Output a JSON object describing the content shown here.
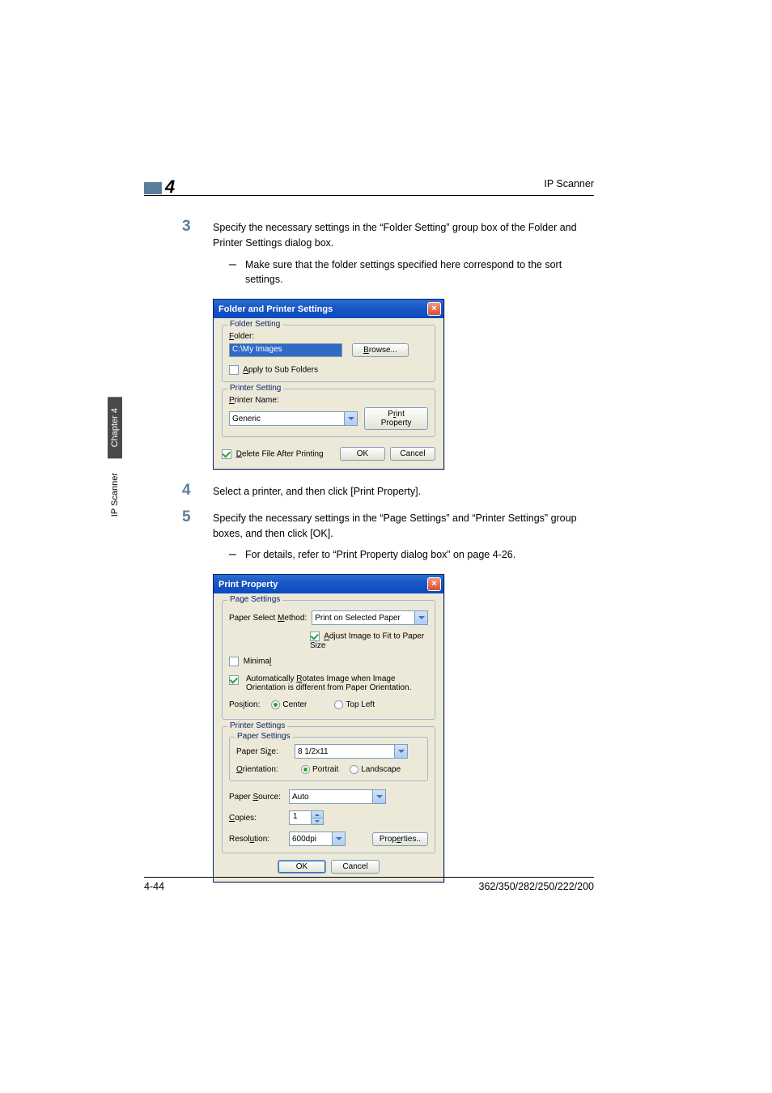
{
  "header": {
    "chapter_number": "4",
    "right_text": "IP Scanner"
  },
  "side_tab": {
    "dark": "Chapter 4",
    "light": "IP Scanner"
  },
  "steps": {
    "s3": {
      "num": "3",
      "text": "Specify the necessary settings in the “Folder Setting” group box of the Folder and Printer Settings dialog box.",
      "bullet": "Make sure that the folder settings specified here correspond to the sort settings."
    },
    "s4": {
      "num": "4",
      "text": "Select a printer, and then click [Print Property]."
    },
    "s5": {
      "num": "5",
      "text": "Specify the necessary settings in the “Page Settings” and “Printer Settings” group boxes, and then click [OK].",
      "bullet": "For details, refer to “Print Property dialog box” on page 4-26."
    }
  },
  "dialog1": {
    "title": "Folder and Printer Settings",
    "folder_setting": {
      "legend": "Folder Setting",
      "folder_label": "Folder:",
      "folder_label_u": "F",
      "folder_value": "C:\\My Images",
      "browse": "Browse...",
      "browse_u": "B",
      "apply_sub": "Apply to Sub Folders",
      "apply_sub_u": "A"
    },
    "printer_setting": {
      "legend": "Printer Setting",
      "printer_label": "Printer Name:",
      "printer_label_u": "P",
      "printer_value": "Generic",
      "print_property": "Print Property",
      "print_property_u": "r"
    },
    "delete_after": "Delete File After Printing",
    "delete_after_u": "D",
    "ok": "OK",
    "cancel": "Cancel"
  },
  "dialog2": {
    "title": "Print Property",
    "page_settings": {
      "legend": "Page Settings",
      "method_label": "Paper Select Method:",
      "method_u": "M",
      "method_value": "Print on Selected Paper",
      "adjust": "Adjust Image to Fit to Paper Size",
      "adjust_u": "A",
      "minimal": "Minimal",
      "minimal_u": "l",
      "auto_rotate": "Automatically Rotates Image when Image Orientation is different from Paper Orientation.",
      "auto_rotate_u": "R",
      "position_label": "Position:",
      "position_u": "i",
      "pos_center": "Center",
      "pos_topleft": "Top Left"
    },
    "printer_settings": {
      "legend": "Printer Settings",
      "paper_settings_legend": "Paper Settings",
      "paper_size_label": "Paper Size:",
      "paper_size_u": "z",
      "paper_size_value": "8 1/2x11",
      "orientation_label": "Orientation:",
      "orientation_u": "O",
      "or_portrait": "Portrait",
      "or_landscape": "Landscape",
      "source_label": "Paper Source:",
      "source_u": "S",
      "source_value": "Auto",
      "copies_label": "Copies:",
      "copies_u": "C",
      "copies_value": "1",
      "resolution_label": "Resolution:",
      "resolution_u": "u",
      "resolution_value": "600dpi",
      "properties": "Properties..",
      "properties_u": "e"
    },
    "ok": "OK",
    "cancel": "Cancel"
  },
  "footer": {
    "left": "4-44",
    "right": "362/350/282/250/222/200"
  }
}
